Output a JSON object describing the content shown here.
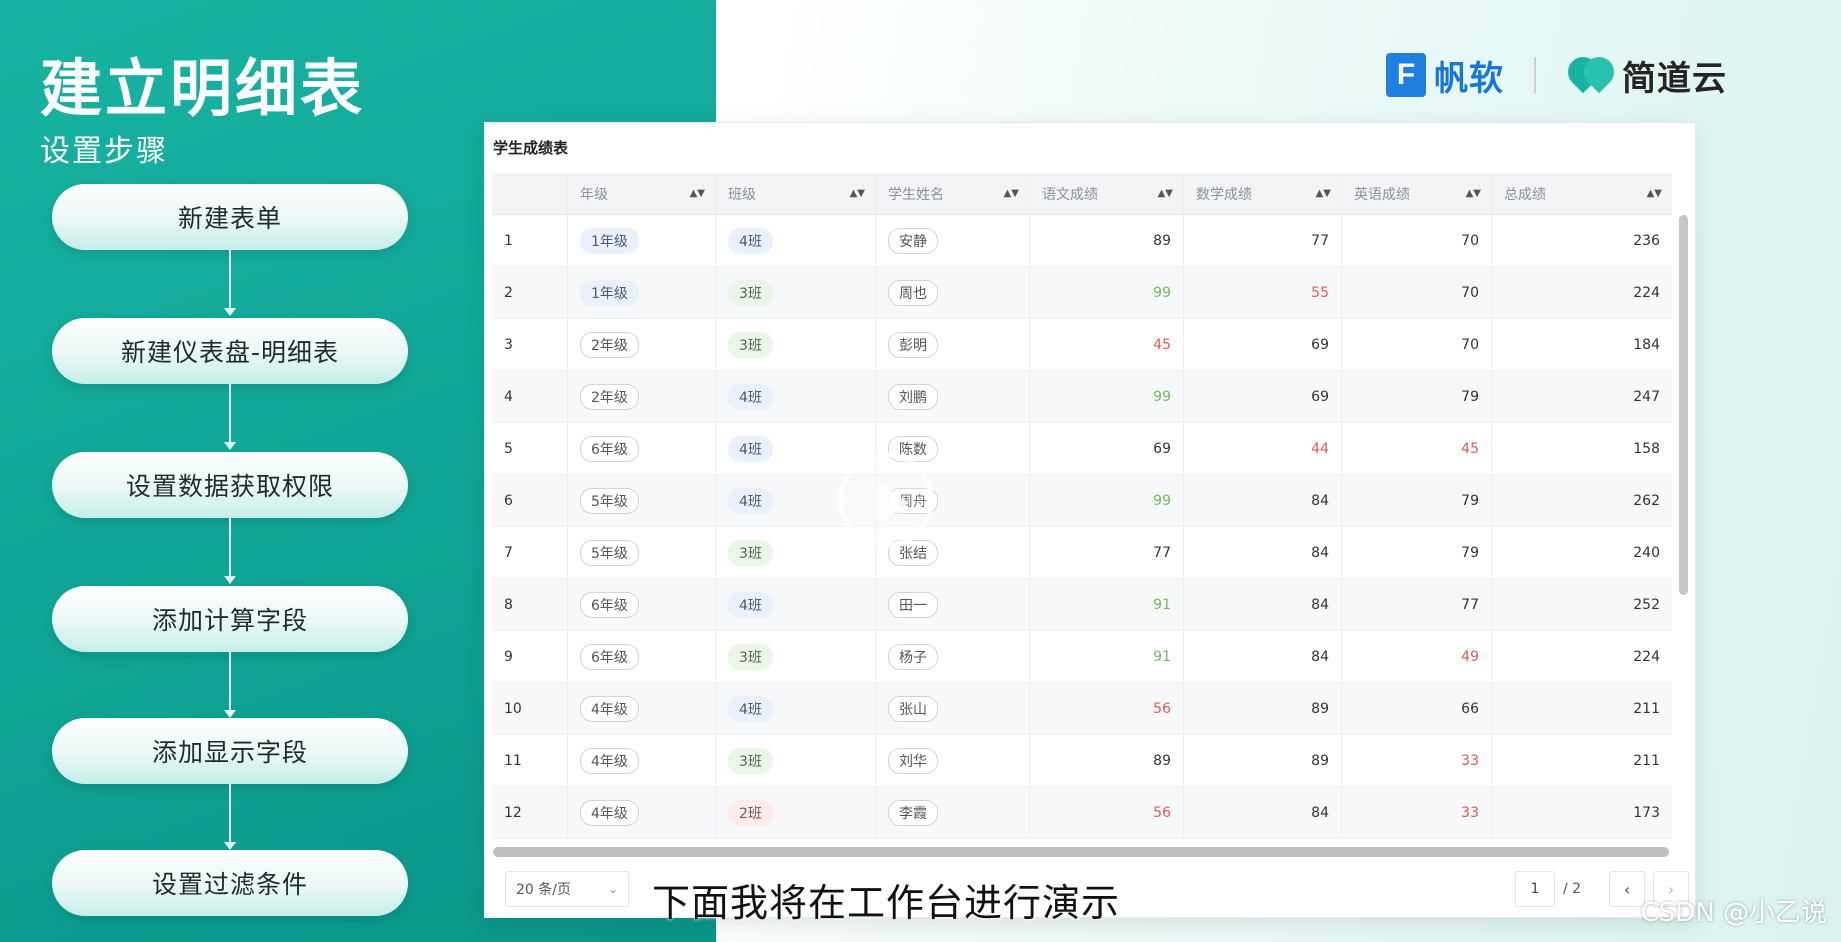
{
  "left": {
    "title": "建立明细表",
    "subtitle": "设置步骤",
    "steps": [
      "新建表单",
      "新建仪表盘-明细表",
      "设置数据获取权限",
      "添加计算字段",
      "添加显示字段",
      "设置过滤条件"
    ]
  },
  "logos": {
    "brand1_mark": "F",
    "brand1": "帆软",
    "brand2": "简道云"
  },
  "table": {
    "title": "学生成绩表",
    "headers": [
      "",
      "年级",
      "班级",
      "学生姓名",
      "语文成绩",
      "数学成绩",
      "英语成绩",
      "总成绩"
    ],
    "sort_glyph": "▲▼",
    "rows": [
      {
        "no": "1",
        "grade": "1年级",
        "grade_style": "blue",
        "cls": "4班",
        "cls_style": "blue",
        "name": "安静",
        "chinese": "89",
        "chinese_c": "black",
        "math": "77",
        "math_c": "black",
        "english": "70",
        "english_c": "black",
        "total": "236"
      },
      {
        "no": "2",
        "grade": "1年级",
        "grade_style": "blue",
        "cls": "3班",
        "cls_style": "green",
        "name": "周也",
        "chinese": "99",
        "chinese_c": "green",
        "math": "55",
        "math_c": "red",
        "english": "70",
        "english_c": "black",
        "total": "224"
      },
      {
        "no": "3",
        "grade": "2年级",
        "grade_style": "outline",
        "cls": "3班",
        "cls_style": "green",
        "name": "彭明",
        "chinese": "45",
        "chinese_c": "red",
        "math": "69",
        "math_c": "black",
        "english": "70",
        "english_c": "black",
        "total": "184"
      },
      {
        "no": "4",
        "grade": "2年级",
        "grade_style": "outline",
        "cls": "4班",
        "cls_style": "blue",
        "name": "刘鹏",
        "chinese": "99",
        "chinese_c": "green",
        "math": "69",
        "math_c": "black",
        "english": "79",
        "english_c": "black",
        "total": "247"
      },
      {
        "no": "5",
        "grade": "6年级",
        "grade_style": "outline",
        "cls": "4班",
        "cls_style": "blue",
        "name": "陈数",
        "chinese": "69",
        "chinese_c": "black",
        "math": "44",
        "math_c": "red",
        "english": "45",
        "english_c": "red",
        "total": "158"
      },
      {
        "no": "6",
        "grade": "5年级",
        "grade_style": "outline",
        "cls": "4班",
        "cls_style": "blue",
        "name": "周舟",
        "chinese": "99",
        "chinese_c": "green",
        "math": "84",
        "math_c": "black",
        "english": "79",
        "english_c": "black",
        "total": "262"
      },
      {
        "no": "7",
        "grade": "5年级",
        "grade_style": "outline",
        "cls": "3班",
        "cls_style": "green",
        "name": "张结",
        "chinese": "77",
        "chinese_c": "black",
        "math": "84",
        "math_c": "black",
        "english": "79",
        "english_c": "black",
        "total": "240"
      },
      {
        "no": "8",
        "grade": "6年级",
        "grade_style": "outline",
        "cls": "4班",
        "cls_style": "blue",
        "name": "田一",
        "chinese": "91",
        "chinese_c": "green",
        "math": "84",
        "math_c": "black",
        "english": "77",
        "english_c": "black",
        "total": "252"
      },
      {
        "no": "9",
        "grade": "6年级",
        "grade_style": "outline",
        "cls": "3班",
        "cls_style": "green",
        "name": "杨子",
        "chinese": "91",
        "chinese_c": "green",
        "math": "84",
        "math_c": "black",
        "english": "49",
        "english_c": "red",
        "total": "224"
      },
      {
        "no": "10",
        "grade": "4年级",
        "grade_style": "outline",
        "cls": "4班",
        "cls_style": "blue",
        "name": "张山",
        "chinese": "56",
        "chinese_c": "red",
        "math": "89",
        "math_c": "black",
        "english": "66",
        "english_c": "black",
        "total": "211"
      },
      {
        "no": "11",
        "grade": "4年级",
        "grade_style": "outline",
        "cls": "3班",
        "cls_style": "green",
        "name": "刘华",
        "chinese": "89",
        "chinese_c": "black",
        "math": "89",
        "math_c": "black",
        "english": "33",
        "english_c": "red",
        "total": "211"
      },
      {
        "no": "12",
        "grade": "4年级",
        "grade_style": "outline",
        "cls": "2班",
        "cls_style": "pink",
        "name": "李霞",
        "chinese": "56",
        "chinese_c": "red",
        "math": "84",
        "math_c": "black",
        "english": "33",
        "english_c": "red",
        "total": "173"
      }
    ]
  },
  "pagination": {
    "page_size": "20 条/页",
    "current_page": "1",
    "total_pages": "/ 2",
    "prev": "‹",
    "next": "›"
  },
  "subtitle_caption": "下面我将在工作台进行演示",
  "watermark": "CSDN @小乙说",
  "colors": {
    "teal": "#10a596",
    "fanruan_blue": "#1677d6",
    "score_green": "#6bbf5b",
    "score_red": "#e05a52"
  }
}
